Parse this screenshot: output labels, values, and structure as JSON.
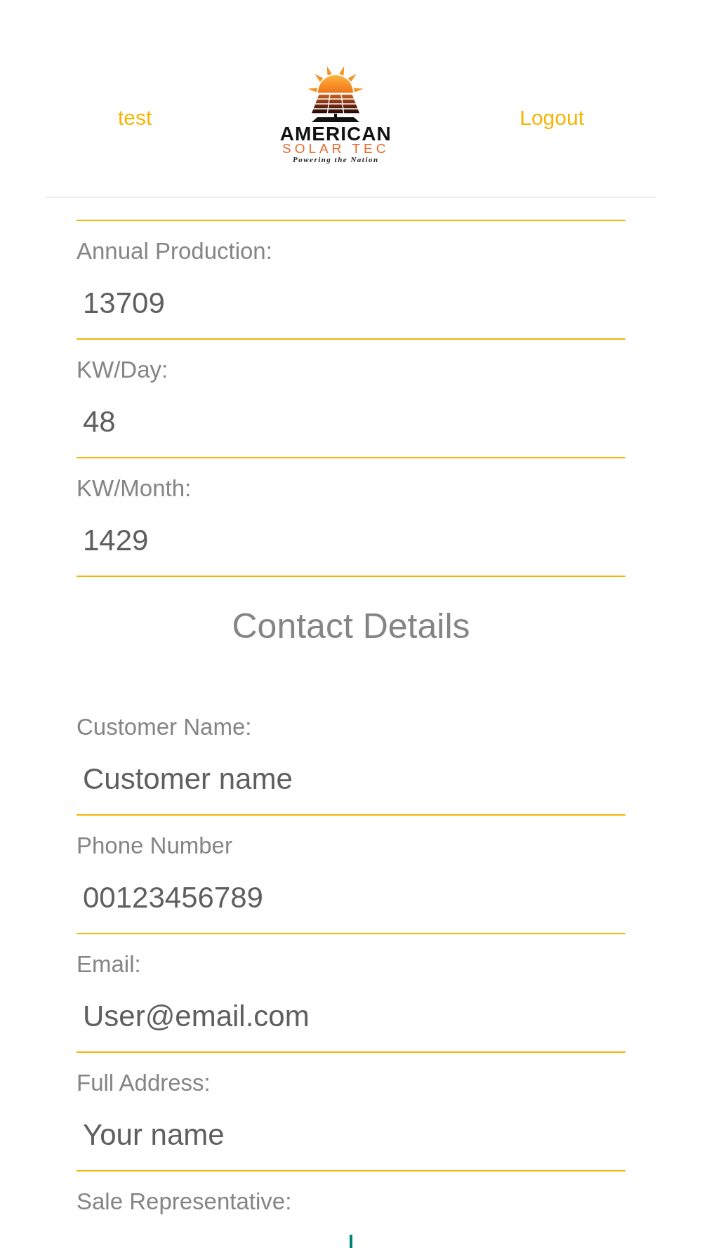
{
  "header": {
    "user_link": "test",
    "logo": {
      "wordmark": "AMERICAN",
      "subtitle": "SOLAR TEC",
      "tagline": "Powering the Nation"
    },
    "logout_link": "Logout"
  },
  "production_fields": [
    {
      "label": "Annual Production:",
      "value": "13709",
      "focused": false
    },
    {
      "label": "KW/Day:",
      "value": "48",
      "focused": false
    },
    {
      "label": "KW/Month:",
      "value": "1429",
      "focused": false
    }
  ],
  "section_title": "Contact Details",
  "contact_fields": [
    {
      "label": "Customer Name:",
      "value": "Customer name",
      "focused": false
    },
    {
      "label": "Phone Number",
      "value": "00123456789",
      "focused": false
    },
    {
      "label": "Email:",
      "value": "User@email.com",
      "focused": false
    },
    {
      "label": "Full Address:",
      "value": "Your name",
      "focused": false
    },
    {
      "label": "Sale Representative:",
      "focused": true
    }
  ]
}
